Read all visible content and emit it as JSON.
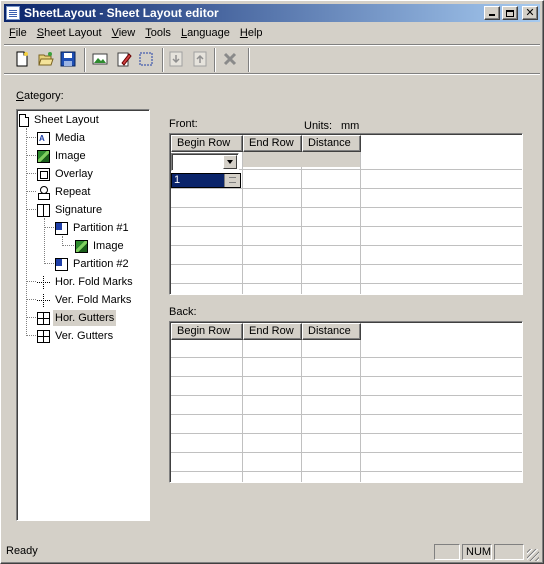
{
  "window": {
    "title": "SheetLayout - Sheet Layout editor"
  },
  "menu": [
    {
      "pre": "",
      "ul": "F",
      "post": "ile"
    },
    {
      "pre": "",
      "ul": "S",
      "post": "heet Layout"
    },
    {
      "pre": "",
      "ul": "V",
      "post": "iew"
    },
    {
      "pre": "",
      "ul": "T",
      "post": "ools"
    },
    {
      "pre": "",
      "ul": "L",
      "post": "anguage"
    },
    {
      "pre": "",
      "ul": "H",
      "post": "elp"
    }
  ],
  "toolbar": {
    "icons": [
      "new-icon",
      "open-icon",
      "save-icon",
      "image-icon",
      "edit-icon",
      "select-icon",
      "move-down-icon",
      "move-up-icon",
      "delete-icon"
    ]
  },
  "category": {
    "label_ul": "C",
    "label_rest": "ategory:"
  },
  "tree": [
    {
      "label": "Sheet Layout",
      "icon": "page-icon"
    },
    {
      "label": "Media",
      "icon": "media-icon"
    },
    {
      "label": "Image",
      "icon": "image-icon"
    },
    {
      "label": "Overlay",
      "icon": "overlay-icon"
    },
    {
      "label": "Repeat",
      "icon": "repeat-icon"
    },
    {
      "label": "Signature",
      "icon": "signature-icon"
    },
    {
      "label": "Partition #1",
      "icon": "partition-icon"
    },
    {
      "label": "Image",
      "icon": "image-icon"
    },
    {
      "label": "Partition #2",
      "icon": "partition-icon"
    },
    {
      "label": "Hor. Fold Marks",
      "icon": "fold-marks-icon"
    },
    {
      "label": "Ver. Fold Marks",
      "icon": "fold-marks-icon"
    },
    {
      "label": "Hor. Gutters",
      "icon": "gutters-icon",
      "selected": true
    },
    {
      "label": "Ver. Gutters",
      "icon": "gutters-icon"
    }
  ],
  "front": {
    "label": "Front:",
    "units_label": "Units:",
    "units_value": "mm",
    "columns": [
      "Begin Row",
      "End Row",
      "Distance"
    ],
    "begin_row_value": "1"
  },
  "back": {
    "label": "Back:",
    "columns": [
      "Begin Row",
      "End Row",
      "Distance"
    ]
  },
  "status": {
    "text": "Ready",
    "num": "NUM"
  }
}
